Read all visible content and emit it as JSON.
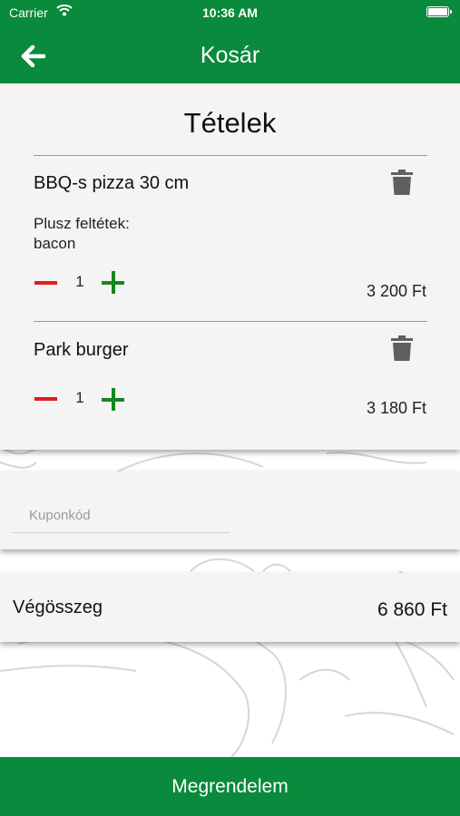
{
  "status_bar": {
    "carrier": "Carrier",
    "time": "10:36 AM"
  },
  "header": {
    "title": "Kosár",
    "back_icon": "arrow-left-icon"
  },
  "cart": {
    "heading": "Tételek",
    "items": [
      {
        "name": "BBQ-s pizza 30 cm",
        "extras_label": "Plusz feltétek:",
        "extras": "bacon",
        "quantity": "1",
        "price": "3 200 Ft"
      },
      {
        "name": "Park burger",
        "quantity": "1",
        "price": "3 180 Ft"
      }
    ]
  },
  "coupon": {
    "placeholder": "Kuponkód",
    "value": ""
  },
  "total": {
    "label": "Végösszeg",
    "value": "6 860 Ft"
  },
  "order_button": {
    "label": "Megrendelem"
  },
  "colors": {
    "brand_green": "#0a8a3c",
    "minus_red": "#e21b1b",
    "plus_green": "#14871f",
    "card_bg": "#f4f4f4"
  }
}
